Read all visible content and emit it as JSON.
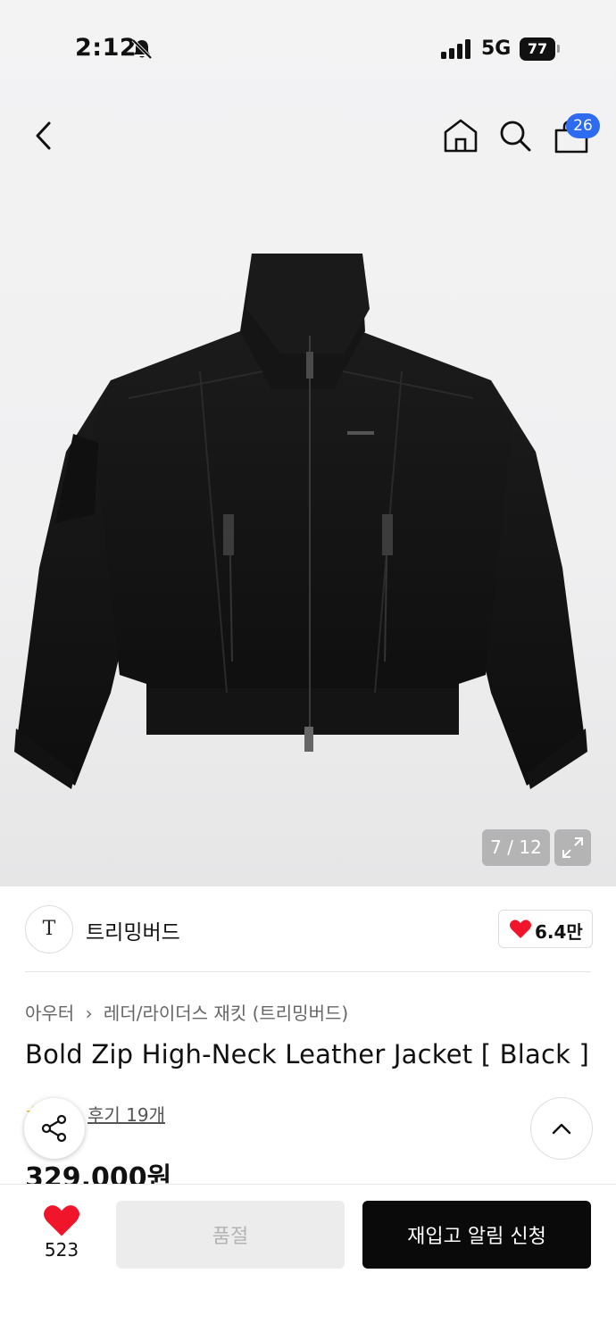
{
  "status": {
    "time": "2:12",
    "network": "5G",
    "battery": "77"
  },
  "topbar": {
    "cart_badge": "26"
  },
  "gallery": {
    "pager": "7 / 12"
  },
  "brand": {
    "logo_text": "T",
    "name": "트리밍버드",
    "like_count": "6.4만"
  },
  "product": {
    "breadcrumb": [
      "아우터",
      "레더/라이더스 재킷 (트리밍버드)"
    ],
    "title": "Bold Zip High-Neck Leather Jacket [ Black ]",
    "review_link": "후기 19개",
    "price": "329,000원"
  },
  "bottom": {
    "wish_count": "523",
    "soldout_label": "품절",
    "restock_label": "재입고 알림 신청"
  },
  "colors": {
    "accent_blue": "#2d6bf0",
    "heart_red": "#f0152a",
    "star_yellow": "#f5b301"
  }
}
